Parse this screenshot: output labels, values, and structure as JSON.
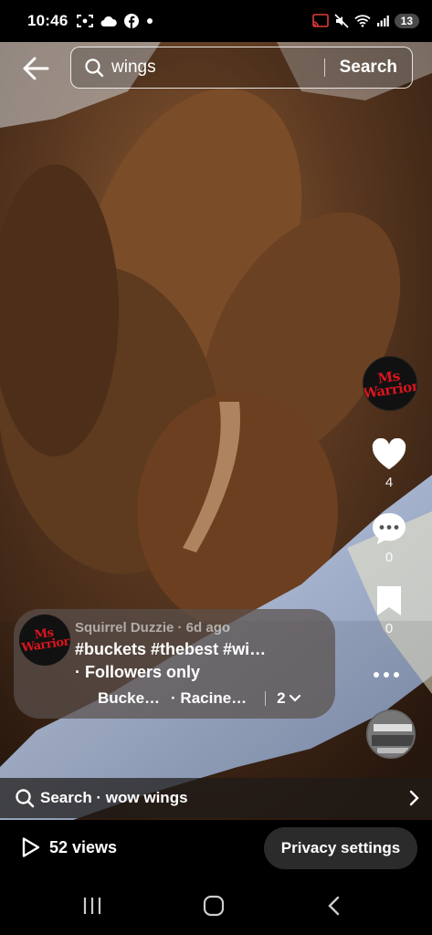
{
  "status_bar": {
    "time": "10:46",
    "battery": "13"
  },
  "search": {
    "query": "wings",
    "button_label": "Search"
  },
  "rail": {
    "avatar_text": "Ms Warrior",
    "likes": "4",
    "comments": "0",
    "saves": "0"
  },
  "caption": {
    "avatar_text": "Ms Warrior",
    "meta": "Squirrel Duzzie · 6d ago",
    "tags": "#buckets #thebest #wi…",
    "followers": "· Followers only",
    "chip1": "Bucke…",
    "chip2": "· Racine…",
    "more_count": "2"
  },
  "suggestion": {
    "text": "Search · wow wings"
  },
  "bottom": {
    "views": "52 views",
    "privacy_label": "Privacy settings"
  },
  "colors": {
    "accent_red": "#d9151d",
    "bottom_pill": "#2b2b2b"
  },
  "icons": [
    "back-arrow-icon",
    "search-icon",
    "heart-icon",
    "comment-icon",
    "bookmark-icon",
    "more-icon",
    "play-icon",
    "chevron-right-icon",
    "chevron-down-icon"
  ]
}
